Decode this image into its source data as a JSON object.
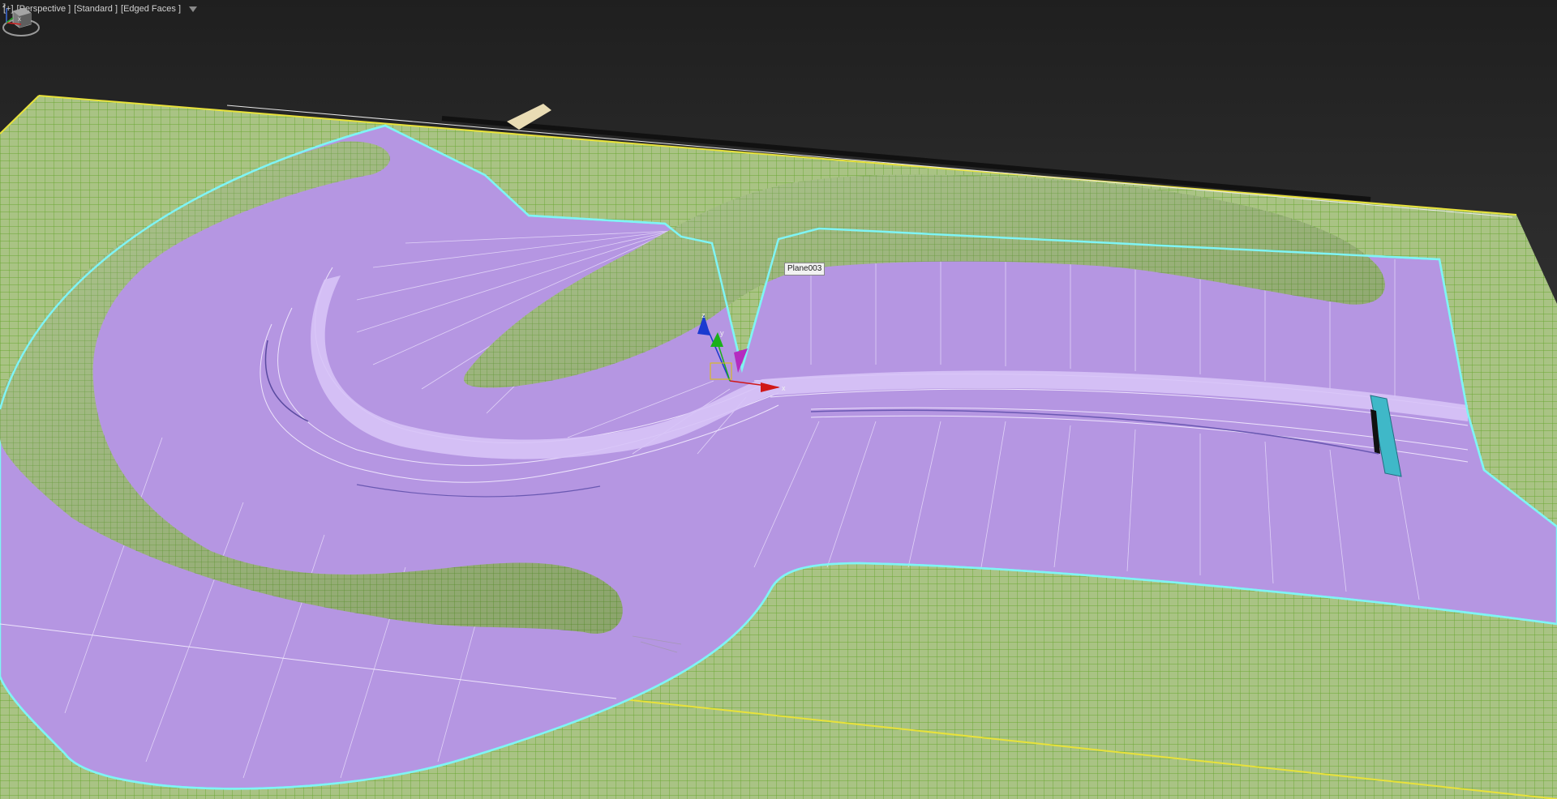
{
  "viewport": {
    "labels": [
      "[+]",
      "[Perspective ]",
      "[Standard ]",
      "[Edged Faces ]"
    ],
    "filter_icon": "funnel-icon",
    "object_tooltip": "Plane003",
    "gizmo_axes": {
      "x": "x",
      "y": "y",
      "z": "z"
    },
    "corner_axes": {
      "x": "x",
      "z": "z"
    },
    "viewcube_icon": "viewcube-icon"
  },
  "colors": {
    "terrain": "#a6c081",
    "terrain_wire": "#6aa832",
    "road_plane": "#b596e2",
    "road_plane_light": "#d5bff5",
    "selection_outline": "#7ff4f4",
    "boundary": "#e8e23a",
    "background_top": "#1f1f1f",
    "background_bottom": "#474747",
    "cyan_object": "#3fb8c8"
  }
}
